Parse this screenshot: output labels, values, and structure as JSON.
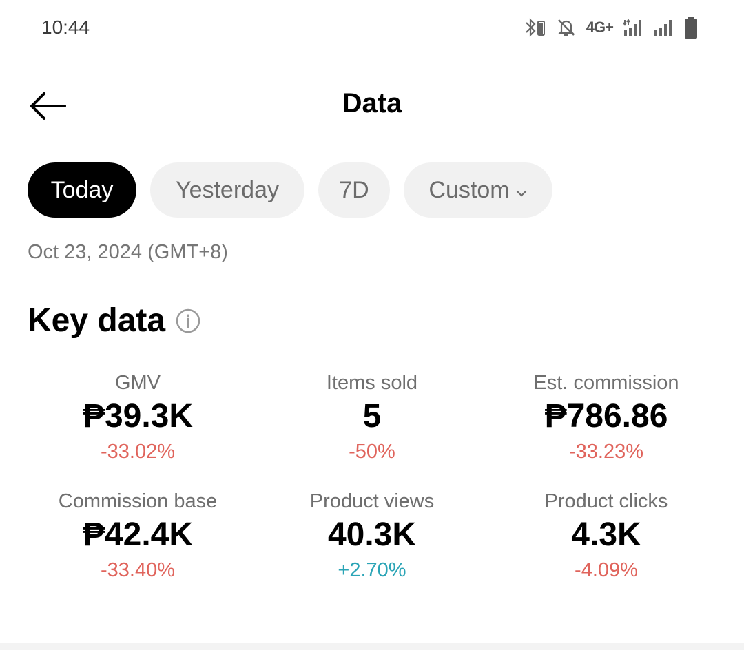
{
  "status_bar": {
    "time": "10:44",
    "network": "4G+",
    "icons": [
      "bluetooth-battery-icon",
      "mute-icon",
      "signal-icon",
      "signal-icon",
      "battery-icon"
    ]
  },
  "header": {
    "title": "Data",
    "back_icon": "arrow-left-icon"
  },
  "range_tabs": [
    {
      "label": "Today",
      "active": true
    },
    {
      "label": "Yesterday",
      "active": false
    },
    {
      "label": "7D",
      "active": false
    },
    {
      "label": "Custom",
      "active": false,
      "icon": "chevron-down-icon"
    }
  ],
  "date_range": "Oct 23, 2024 (GMT+8)",
  "key_data": {
    "title": "Key data",
    "info_icon": "info-icon",
    "metrics": [
      {
        "label": "GMV",
        "value": "₱39.3K",
        "change": "-33.02%",
        "trend": "down"
      },
      {
        "label": "Items sold",
        "value": "5",
        "change": "-50%",
        "trend": "down"
      },
      {
        "label": "Est. commission",
        "value": "₱786.86",
        "change": "-33.23%",
        "trend": "down"
      },
      {
        "label": "Commission base",
        "value": "₱42.4K",
        "change": "-33.40%",
        "trend": "down"
      },
      {
        "label": "Product views",
        "value": "40.3K",
        "change": "+2.70%",
        "trend": "up"
      },
      {
        "label": "Product clicks",
        "value": "4.3K",
        "change": "-4.09%",
        "trend": "down"
      }
    ]
  },
  "colors": {
    "negative": "#e0645c",
    "positive": "#2aa4b6",
    "pill_active_bg": "#000000",
    "pill_bg": "#f1f1f1"
  }
}
